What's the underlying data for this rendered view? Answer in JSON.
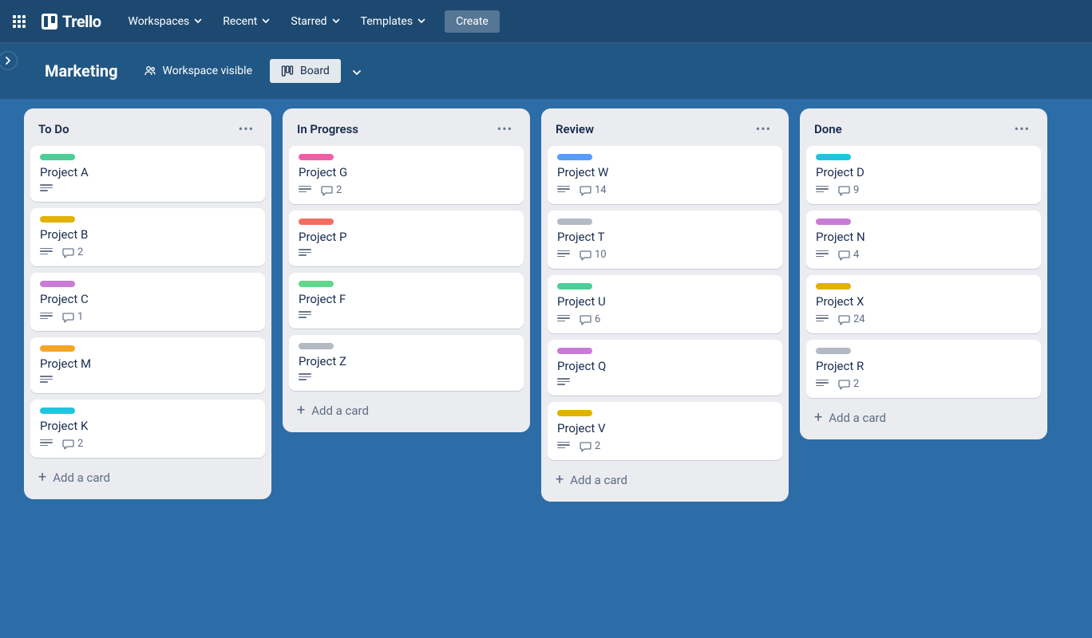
{
  "app": {
    "logo_text": "Trello",
    "nav": [
      {
        "label": "Workspaces"
      },
      {
        "label": "Recent"
      },
      {
        "label": "Starred"
      },
      {
        "label": "Templates"
      }
    ],
    "create_label": "Create"
  },
  "board": {
    "title": "Marketing",
    "visibility_label": "Workspace visible",
    "view_label": "Board"
  },
  "add_card_label": "Add a card",
  "label_colors": {
    "green": "#4bce97",
    "yellow": "#e2b203",
    "purple": "#c97cd5",
    "orange": "#f5a623",
    "cyan": "#1fc5e0",
    "pink": "#f25fa7",
    "red": "#f26d5f",
    "lightgreen": "#60d78b",
    "grey": "#b4bac4",
    "blue": "#579dff"
  },
  "lists": [
    {
      "title": "To Do",
      "cards": [
        {
          "label": "green",
          "title": "Project A",
          "has_desc": true,
          "comments": null
        },
        {
          "label": "yellow",
          "title": "Project B",
          "has_desc": true,
          "comments": 2
        },
        {
          "label": "purple",
          "title": "Project C",
          "has_desc": true,
          "comments": 1
        },
        {
          "label": "orange",
          "title": "Project M",
          "has_desc": true,
          "comments": null
        },
        {
          "label": "cyan",
          "title": "Project K",
          "has_desc": true,
          "comments": 2
        }
      ]
    },
    {
      "title": "In Progress",
      "cards": [
        {
          "label": "pink",
          "title": "Project G",
          "has_desc": true,
          "comments": 2
        },
        {
          "label": "red",
          "title": "Project P",
          "has_desc": true,
          "comments": null
        },
        {
          "label": "lightgreen",
          "title": "Project F",
          "has_desc": true,
          "comments": null
        },
        {
          "label": "grey",
          "title": "Project Z",
          "has_desc": true,
          "comments": null
        }
      ]
    },
    {
      "title": "Review",
      "cards": [
        {
          "label": "blue",
          "title": "Project W",
          "has_desc": true,
          "comments": 14
        },
        {
          "label": "grey",
          "title": "Project T",
          "has_desc": true,
          "comments": 10
        },
        {
          "label": "green",
          "title": "Project U",
          "has_desc": true,
          "comments": 6
        },
        {
          "label": "purple",
          "title": "Project Q",
          "has_desc": true,
          "comments": null
        },
        {
          "label": "yellow",
          "title": "Project V",
          "has_desc": true,
          "comments": 2
        }
      ]
    },
    {
      "title": "Done",
      "cards": [
        {
          "label": "cyan",
          "title": "Project D",
          "has_desc": true,
          "comments": 9
        },
        {
          "label": "purple",
          "title": "Project N",
          "has_desc": true,
          "comments": 4
        },
        {
          "label": "yellow",
          "title": "Project X",
          "has_desc": true,
          "comments": 24
        },
        {
          "label": "grey",
          "title": "Project R",
          "has_desc": true,
          "comments": 2
        }
      ]
    }
  ]
}
